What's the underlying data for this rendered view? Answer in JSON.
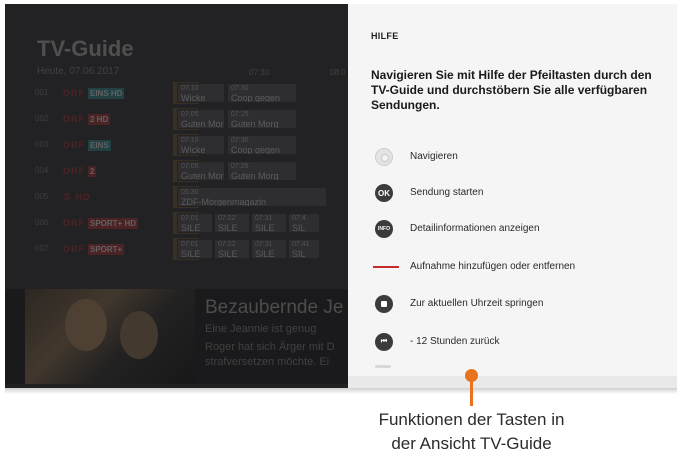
{
  "guide": {
    "title": "TV-Guide",
    "date": "Heute, 07.06.2017",
    "ticks": [
      "07:30",
      "08:0"
    ],
    "channels": [
      {
        "num": "001",
        "logo": "ORF",
        "sub": "EINS HD",
        "sub_color": "#2a5a5a",
        "programs": [
          {
            "time": "07:10",
            "name": "Wicke"
          },
          {
            "time": "07:30",
            "name": "Coop gegen"
          }
        ]
      },
      {
        "num": "002",
        "logo": "ORF",
        "sub": "2 HD",
        "sub_color": "#6a2c2c",
        "programs": [
          {
            "time": "07:05",
            "name": "Guten Morg"
          },
          {
            "time": "07:25",
            "name": "Guten Morg"
          }
        ]
      },
      {
        "num": "003",
        "logo": "ORF",
        "sub": "EINS",
        "sub_color": "#2a5a5a",
        "programs": [
          {
            "time": "07:10",
            "name": "Wicke"
          },
          {
            "time": "07:30",
            "name": "Coop gegen"
          }
        ]
      },
      {
        "num": "004",
        "logo": "ORF",
        "sub": "2",
        "sub_color": "#6a2c2c",
        "programs": [
          {
            "time": "07:05",
            "name": "Guten Morg"
          },
          {
            "time": "07:25",
            "name": "Guten Morg"
          }
        ]
      },
      {
        "num": "005",
        "logo": "① HD",
        "sub": "",
        "sub_color": "#333333",
        "programs": [
          {
            "time": "05:30",
            "name": "ZDF-Morgenmagazin"
          }
        ]
      },
      {
        "num": "006",
        "logo": "ORF",
        "sub": "SPORT+ HD",
        "sub_color": "#6a2c2c",
        "programs": [
          {
            "time": "07:01",
            "name": "SILE"
          },
          {
            "time": "07:22",
            "name": "SILE"
          },
          {
            "time": "07:31",
            "name": "SILE"
          },
          {
            "time": "07:4",
            "name": "SIL"
          }
        ]
      },
      {
        "num": "007",
        "logo": "ORF",
        "sub": "SPORT+",
        "sub_color": "#6a2c2c",
        "programs": [
          {
            "time": "07:01",
            "name": "SILE"
          },
          {
            "time": "07:22",
            "name": "SILE"
          },
          {
            "time": "07:31",
            "name": "SILE"
          },
          {
            "time": "07:41",
            "name": "SIL"
          }
        ]
      }
    ]
  },
  "preview": {
    "title": "Bezaubernde Je",
    "subtitle": "Eine Jeannie ist genug",
    "desc_line1": "Roger hat sich Ärger mit D",
    "desc_line2": "strafversetzen möchte. Ei"
  },
  "help": {
    "heading": "HILFE",
    "intro": "Navigieren Sie mit Hilfe der Pfeiltasten durch den TV-Guide und durchstöbern Sie alle verfügbaren Sendungen.",
    "items": [
      {
        "icon": "dpad-icon",
        "glyph": "",
        "label": "Navigieren"
      },
      {
        "icon": "ok-button-icon",
        "glyph": "OK",
        "label": "Sendung starten"
      },
      {
        "icon": "info-button-icon",
        "glyph": "INFO",
        "label": "Detailinformationen anzeigen"
      },
      {
        "icon": "red-button-icon",
        "glyph": "",
        "label": "Aufnahme hinzufügen oder entfernen"
      },
      {
        "icon": "stop-button-icon",
        "glyph": "",
        "label": "Zur aktuellen Uhrzeit springen"
      },
      {
        "icon": "skip-back-icon",
        "glyph": "⏮",
        "label": "- 12 Stunden zurück"
      }
    ]
  },
  "caption": {
    "line1": "Funktionen der Tasten in",
    "line2": "der Ansicht TV-Guide"
  },
  "colors": {
    "accent_orange": "#e8731f",
    "record_red": "#c62a2a"
  }
}
